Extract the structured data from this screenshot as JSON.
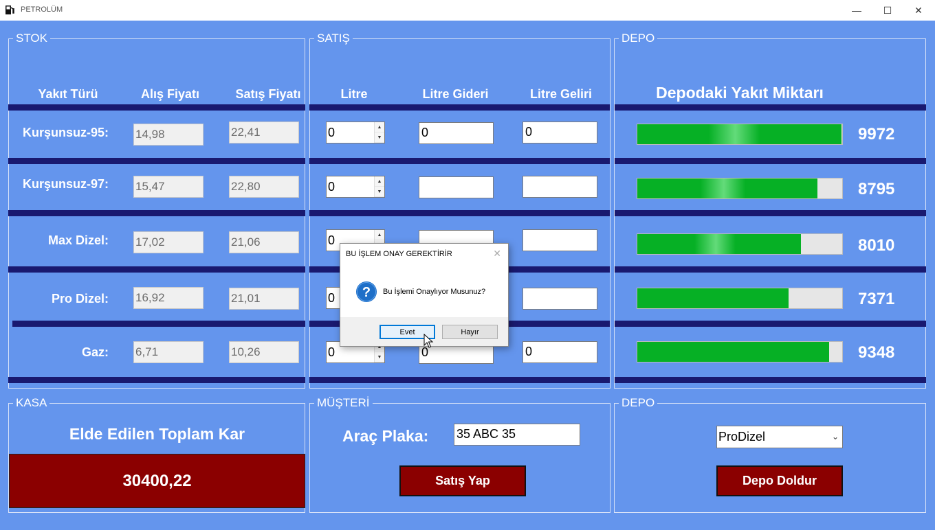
{
  "window": {
    "title": "PETROLÜM",
    "minimize": "—",
    "maximize": "☐",
    "close": "✕"
  },
  "stok": {
    "title": "STOK",
    "headers": {
      "fuel_type": "Yakıt Türü",
      "buy_price": "Alış Fiyatı",
      "sell_price": "Satış Fiyatı"
    },
    "rows": [
      {
        "label": "Kurşunsuz-95:",
        "buy": "14,98",
        "sell": "22,41"
      },
      {
        "label": "Kurşunsuz-97:",
        "buy": "15,47",
        "sell": "22,80"
      },
      {
        "label": "Max Dizel:",
        "buy": "17,02",
        "sell": "21,06"
      },
      {
        "label": "Pro Dizel:",
        "buy": "16,92",
        "sell": "21,01"
      },
      {
        "label": "Gaz:",
        "buy": "6,71",
        "sell": "10,26"
      }
    ]
  },
  "satis": {
    "title": "SATIŞ",
    "headers": {
      "litre": "Litre",
      "litre_cost": "Litre Gideri",
      "litre_income": "Litre Geliri"
    },
    "rows": [
      {
        "litre": "0",
        "cost": "0",
        "income": "0"
      },
      {
        "litre": "0",
        "cost": "",
        "income": ""
      },
      {
        "litre": "0",
        "cost": "",
        "income": ""
      },
      {
        "litre": "0",
        "cost": "",
        "income": ""
      },
      {
        "litre": "0",
        "cost": "0",
        "income": "0"
      }
    ]
  },
  "depo": {
    "title": "DEPO",
    "header": "Depodaki Yakıt Miktarı",
    "tanks": [
      {
        "amount": "9972",
        "level": 0.997
      },
      {
        "amount": "8795",
        "level": 0.88
      },
      {
        "amount": "8010",
        "level": 0.8
      },
      {
        "amount": "7371",
        "level": 0.737
      },
      {
        "amount": "9348",
        "level": 0.935
      }
    ]
  },
  "kasa": {
    "title": "KASA",
    "label": "Elde Edilen Toplam Kar",
    "total": "30400,22"
  },
  "musteri": {
    "title": "MÜŞTERİ",
    "plate_label": "Araç Plaka:",
    "plate_value": "35 ABC 35",
    "sell_button": "Satış Yap"
  },
  "depo2": {
    "title": "DEPO",
    "selected_fuel": "ProDizel",
    "fill_button": "Depo Doldur"
  },
  "dialog": {
    "title": "BU İŞLEM ONAY GEREKTİRİR",
    "message": "Bu İşlemi Onaylıyor Musunuz?",
    "yes": "Evet",
    "no": "Hayır",
    "close": "✕"
  },
  "colors": {
    "background": "#6495ED",
    "band": "#191970",
    "button": "#8B0000",
    "progress": "#06B025"
  }
}
